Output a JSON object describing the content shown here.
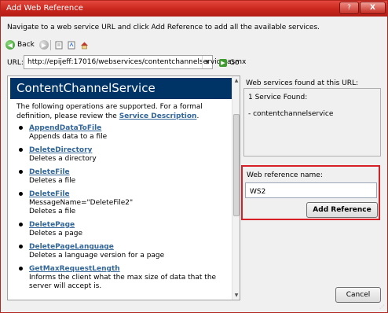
{
  "window": {
    "title": "Add Web Reference",
    "help_button": "?",
    "close_button": "X"
  },
  "instruction": "Navigate to a web service URL and click Add Reference to add all the available services.",
  "toolbar": {
    "back_label": "Back",
    "icons": [
      "back-icon",
      "forward-icon",
      "stop-icon",
      "refresh-icon",
      "home-icon"
    ]
  },
  "url": {
    "label": "URL:",
    "value": "http://epijeff:17016/webservices/contentchannelservice.asmx",
    "go_label": "Go"
  },
  "service_page": {
    "title": "ContentChannelService",
    "intro_text": "The following operations are supported. For a formal definition, please review the ",
    "intro_link": "Service Description",
    "intro_end": ".",
    "operations": [
      {
        "name": "AppendDataToFile",
        "desc": "Appends data to a file"
      },
      {
        "name": "DeleteDirectory",
        "desc": "Deletes a directory"
      },
      {
        "name": "DeleteFile",
        "desc": "Deletes a file"
      },
      {
        "name": "DeleteFile",
        "extra": "MessageName=\"DeleteFile2\"",
        "desc": "Deletes a file"
      },
      {
        "name": "DeletePage",
        "desc": "Deletes a page"
      },
      {
        "name": "DeletePageLanguage",
        "desc": "Deletes a language version for a page"
      },
      {
        "name": "GetMaxRequestLength",
        "desc": "Informs the client what the max size of data that the server will accept is."
      }
    ]
  },
  "services_found": {
    "label": "Web services found at this URL:",
    "count_text": "1 Service Found:",
    "items": [
      "- contentchannelservice"
    ]
  },
  "reference": {
    "label": "Web reference name:",
    "value": "WS2",
    "add_button": "Add Reference"
  },
  "cancel_button": "Cancel"
}
